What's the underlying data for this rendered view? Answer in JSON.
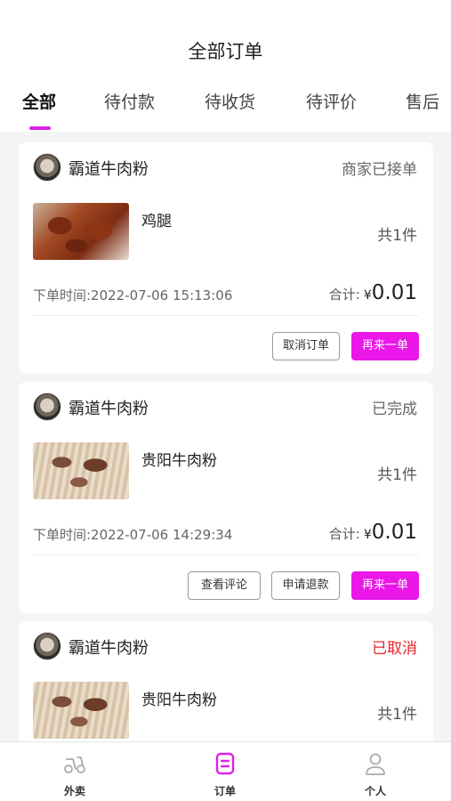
{
  "header": {
    "title": "全部订单"
  },
  "tabs": [
    {
      "label": "全部"
    },
    {
      "label": "待付款"
    },
    {
      "label": "待收货"
    },
    {
      "label": "待评价"
    },
    {
      "label": "售后"
    }
  ],
  "colors": {
    "accent": "#ea17e8",
    "cancelled": "#e8242c"
  },
  "orders": [
    {
      "shop": "霸道牛肉粉",
      "status": "商家已接单",
      "item": "鸡腿",
      "qty": "共1件",
      "time": "下单时间:2022-07-06 15:13:06",
      "total_label": "合计:",
      "currency": "¥",
      "amount": "0.01",
      "buttons": [
        "取消订单",
        "再来一单"
      ]
    },
    {
      "shop": "霸道牛肉粉",
      "status": "已完成",
      "item": "贵阳牛肉粉",
      "qty": "共1件",
      "time": "下单时间:2022-07-06 14:29:34",
      "total_label": "合计:",
      "currency": "¥",
      "amount": "0.01",
      "buttons": [
        "查看评论",
        "申请退款",
        "再来一单"
      ]
    },
    {
      "shop": "霸道牛肉粉",
      "status": "已取消",
      "item": "贵阳牛肉粉",
      "qty": "共1件"
    }
  ],
  "nav": [
    {
      "label": "外卖",
      "icon": "scooter-icon"
    },
    {
      "label": "订单",
      "icon": "order-doc-icon"
    },
    {
      "label": "个人",
      "icon": "person-icon"
    }
  ]
}
